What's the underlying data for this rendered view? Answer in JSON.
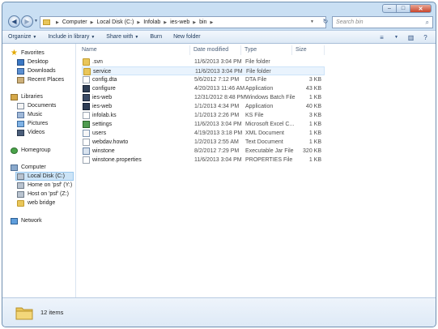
{
  "window": {
    "caption_buttons": [
      "–",
      "□",
      "✕"
    ]
  },
  "navigation": {
    "back_icon": "◀",
    "forward_icon": "▶",
    "history_arrow": "▼",
    "breadcrumb": [
      "Computer",
      "Local Disk (C:)",
      "Infolab",
      "ies-web",
      "bin"
    ],
    "breadcrumb_separator": "▶",
    "refresh_icon": "↻",
    "search_placeholder": "Search bin",
    "search_icon": "⌕"
  },
  "toolbar": {
    "organize": "Organize",
    "include_in_library": "Include in library",
    "share_with": "Share with",
    "burn": "Burn",
    "new_folder": "New folder",
    "dropdown_arrow": "▼",
    "view_icon": "≡",
    "preview_icon": "▥",
    "help_icon": "?"
  },
  "nav_pane": {
    "items": [
      {
        "label": "Favorites",
        "icon": "star-icon"
      },
      {
        "label": "Desktop",
        "icon": "desktop-icon"
      },
      {
        "label": "Downloads",
        "icon": "downloads-icon"
      },
      {
        "label": "Recent Places",
        "icon": "recent-places-icon"
      },
      {
        "label": "Libraries",
        "icon": "libraries-icon"
      },
      {
        "label": "Documents",
        "icon": "documents-icon"
      },
      {
        "label": "Music",
        "icon": "music-icon"
      },
      {
        "label": "Pictures",
        "icon": "pictures-icon"
      },
      {
        "label": "Videos",
        "icon": "videos-icon"
      },
      {
        "label": "Homegroup",
        "icon": "homegroup-icon"
      },
      {
        "label": "Computer",
        "icon": "computer-icon"
      },
      {
        "label": "Local Disk (C:)",
        "icon": "drive-icon",
        "selected": true
      },
      {
        "label": "Home on 'psf' (Y:)",
        "icon": "network-drive-icon"
      },
      {
        "label": "Host on 'psf' (Z:)",
        "icon": "network-drive-icon"
      },
      {
        "label": "web bridge",
        "icon": "folder-icon"
      },
      {
        "label": "Network",
        "icon": "network-icon"
      }
    ]
  },
  "file_list": {
    "columns": [
      "Name",
      "Date modified",
      "Type",
      "Size"
    ],
    "rows": [
      {
        "name": ".svn",
        "date": "11/6/2013 3:04 PM",
        "type": "File folder",
        "size": "",
        "icon": "folder-icon"
      },
      {
        "name": "service",
        "date": "11/6/2013 3:04 PM",
        "type": "File folder",
        "size": "",
        "icon": "folder-icon",
        "hover": true
      },
      {
        "name": "config.dta",
        "date": "5/6/2012 7:12 PM",
        "type": "DTA File",
        "size": "3 KB",
        "icon": "file-icon"
      },
      {
        "name": "configure",
        "date": "4/20/2013 11:46 AM",
        "type": "Application",
        "size": "43 KB",
        "icon": "application-icon"
      },
      {
        "name": "ies-web",
        "date": "12/31/2012 8:48 PM",
        "type": "Windows Batch File",
        "size": "1 KB",
        "icon": "batch-file-icon"
      },
      {
        "name": "ies-web",
        "date": "1/1/2013 4:34 PM",
        "type": "Application",
        "size": "40 KB",
        "icon": "application-icon"
      },
      {
        "name": "infolab.ks",
        "date": "1/1/2013 2:26 PM",
        "type": "KS File",
        "size": "3 KB",
        "icon": "file-icon"
      },
      {
        "name": "settings",
        "date": "11/6/2013 3:04 PM",
        "type": "Microsoft Excel C...",
        "size": "1 KB",
        "icon": "excel-csv-icon"
      },
      {
        "name": "users",
        "date": "4/19/2013 3:18 PM",
        "type": "XML Document",
        "size": "1 KB",
        "icon": "xml-document-icon"
      },
      {
        "name": "webdav.howto",
        "date": "1/2/2013 2:55 AM",
        "type": "Text Document",
        "size": "1 KB",
        "icon": "text-document-icon"
      },
      {
        "name": "winstone",
        "date": "8/2/2012 7:29 PM",
        "type": "Executable Jar File",
        "size": "320 KB",
        "icon": "jar-file-icon"
      },
      {
        "name": "winstone.properties",
        "date": "11/6/2013 3:04 PM",
        "type": "PROPERTIES File",
        "size": "1 KB",
        "icon": "file-icon"
      }
    ]
  },
  "details_pane": {
    "item_count": "12 items",
    "icon": "folder-icon"
  }
}
